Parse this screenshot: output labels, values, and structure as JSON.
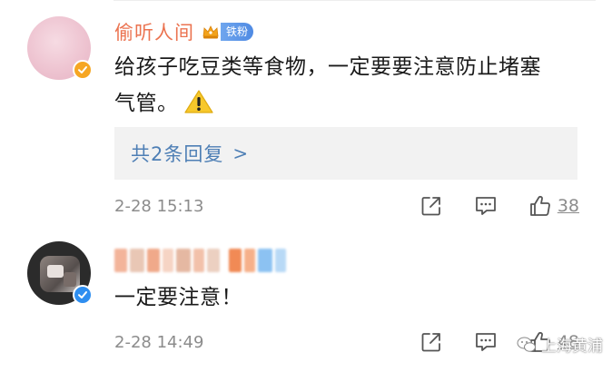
{
  "comments": [
    {
      "username": "偷听人间",
      "fan_badge": "铁粉",
      "text_line1": "给孩子吃豆类等食物，一定要要注意防止堵塞",
      "text_line2": "气管。",
      "replies_label": "共2条回复",
      "replies_chevron": ">",
      "time": "2-28 15:13",
      "likes": "38",
      "verified_color": "#f6a623",
      "icons": [
        "share-icon",
        "comment-icon",
        "like-icon",
        "crown-icon",
        "warning-icon"
      ]
    },
    {
      "text": "一定要注意！",
      "time": "2-28 14:49",
      "likes": "48",
      "verified_color": "#2e8ef0",
      "icons": [
        "share-icon",
        "comment-icon",
        "like-icon"
      ]
    }
  ],
  "watermark": {
    "label": "上海黄浦"
  },
  "colors": {
    "username": "#eb7350",
    "link": "#4e7fb5",
    "meta": "#8c8c8c"
  }
}
